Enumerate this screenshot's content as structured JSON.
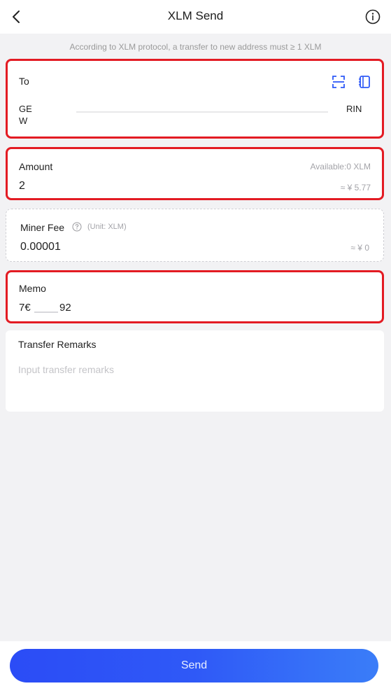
{
  "header": {
    "title": "XLM Send",
    "back_icon": "chevron-left-icon",
    "info_icon": "info-circle-icon"
  },
  "notice": "According to XLM protocol, a transfer to new address must ≥ 1 XLM",
  "to": {
    "label": "To",
    "address_line1_start": "GE",
    "address_line1_end": "RIN",
    "address_line2": "W",
    "scan_icon": "scan-icon",
    "address_book_icon": "address-book-icon"
  },
  "amount": {
    "label": "Amount",
    "available": "Available:0 XLM",
    "value": "2",
    "fiat": "≈ ¥ 5.77"
  },
  "miner_fee": {
    "label": "Miner Fee",
    "unit": "(Unit: XLM)",
    "value": "0.00001",
    "fiat": "≈ ¥ 0",
    "help_icon": "question-circle-icon"
  },
  "memo": {
    "label": "Memo",
    "value_start": "7€",
    "value_end": "92"
  },
  "remarks": {
    "label": "Transfer Remarks",
    "placeholder": "Input transfer remarks"
  },
  "footer": {
    "send_label": "Send"
  },
  "colors": {
    "accent": "#2f59f7",
    "highlight": "#e31b23",
    "background": "#f2f2f4"
  }
}
